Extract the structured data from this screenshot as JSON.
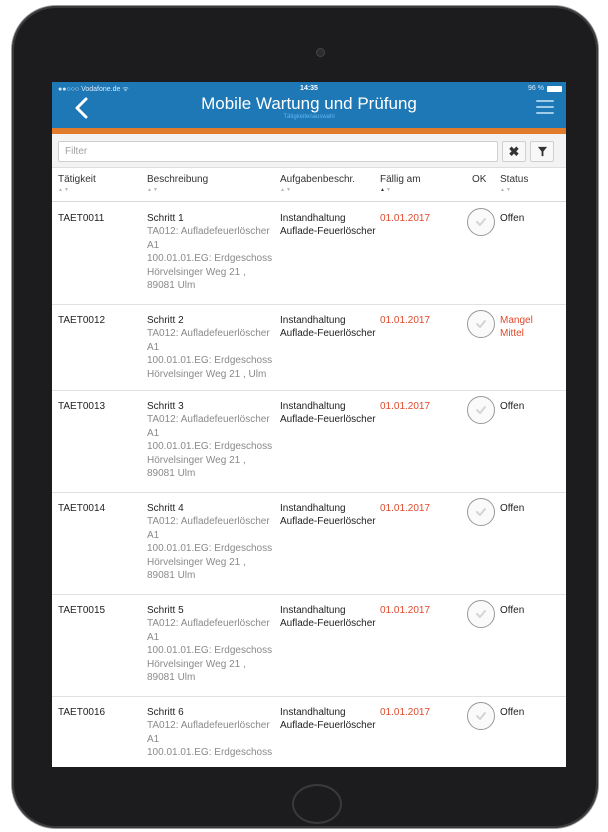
{
  "status_bar": {
    "carrier": "●●○○○ Vodafone.de ᯤ",
    "time": "14:35",
    "battery": "96 %"
  },
  "header": {
    "title": "Mobile Wartung und Prüfung",
    "subtitle": "Tätigkeitenauswahl"
  },
  "colors": {
    "header_bg": "#1e78b6",
    "accent": "#e07c2c",
    "due_date": "#e0492c"
  },
  "filter": {
    "placeholder": "Filter",
    "clear_icon": "close-icon",
    "filter_icon": "funnel-icon"
  },
  "columns": {
    "activity": "Tätigkeit",
    "description": "Beschreibung",
    "task_description": "Aufgabenbeschr.",
    "due": "Fällig am",
    "ok": "OK",
    "status": "Status"
  },
  "rows": [
    {
      "id": "TAET0011",
      "step": "Schritt 1",
      "details": [
        "TA012: Aufladefeuerlöscher",
        "A1",
        "100.01.01.EG: Erdgeschoss",
        "Hörvelsinger Weg 21 ,",
        "89081 Ulm"
      ],
      "task": [
        "Instandhaltung",
        "Auflade-Feuerlöscher"
      ],
      "due": "01.01.2017",
      "status": [
        "Offen"
      ],
      "status_alert": false
    },
    {
      "id": "TAET0012",
      "step": "Schritt 2",
      "details": [
        "TA012: Aufladefeuerlöscher",
        "A1",
        "100.01.01.EG: Erdgeschoss",
        "Hörvelsinger Weg 21 , Ulm"
      ],
      "task": [
        "Instandhaltung",
        "Auflade-Feuerlöscher"
      ],
      "due": "01.01.2017",
      "status": [
        "Mangel",
        "Mittel"
      ],
      "status_alert": true
    },
    {
      "id": "TAET0013",
      "step": "Schritt 3",
      "details": [
        "TA012: Aufladefeuerlöscher",
        "A1",
        "100.01.01.EG: Erdgeschoss",
        "Hörvelsinger Weg 21 ,",
        "89081 Ulm"
      ],
      "task": [
        "Instandhaltung",
        "Auflade-Feuerlöscher"
      ],
      "due": "01.01.2017",
      "status": [
        "Offen"
      ],
      "status_alert": false
    },
    {
      "id": "TAET0014",
      "step": "Schritt 4",
      "details": [
        "TA012: Aufladefeuerlöscher",
        "A1",
        "100.01.01.EG: Erdgeschoss",
        "Hörvelsinger Weg 21 ,",
        "89081 Ulm"
      ],
      "task": [
        "Instandhaltung",
        "Auflade-Feuerlöscher"
      ],
      "due": "01.01.2017",
      "status": [
        "Offen"
      ],
      "status_alert": false
    },
    {
      "id": "TAET0015",
      "step": "Schritt 5",
      "details": [
        "TA012: Aufladefeuerlöscher",
        "A1",
        "100.01.01.EG: Erdgeschoss",
        "Hörvelsinger Weg 21 ,",
        "89081 Ulm"
      ],
      "task": [
        "Instandhaltung",
        "Auflade-Feuerlöscher"
      ],
      "due": "01.01.2017",
      "status": [
        "Offen"
      ],
      "status_alert": false
    },
    {
      "id": "TAET0016",
      "step": "Schritt 6",
      "details": [
        "TA012: Aufladefeuerlöscher",
        "A1",
        "100.01.01.EG: Erdgeschoss"
      ],
      "task": [
        "Instandhaltung",
        "Auflade-Feuerlöscher"
      ],
      "due": "01.01.2017",
      "status": [
        "Offen"
      ],
      "status_alert": false
    }
  ]
}
